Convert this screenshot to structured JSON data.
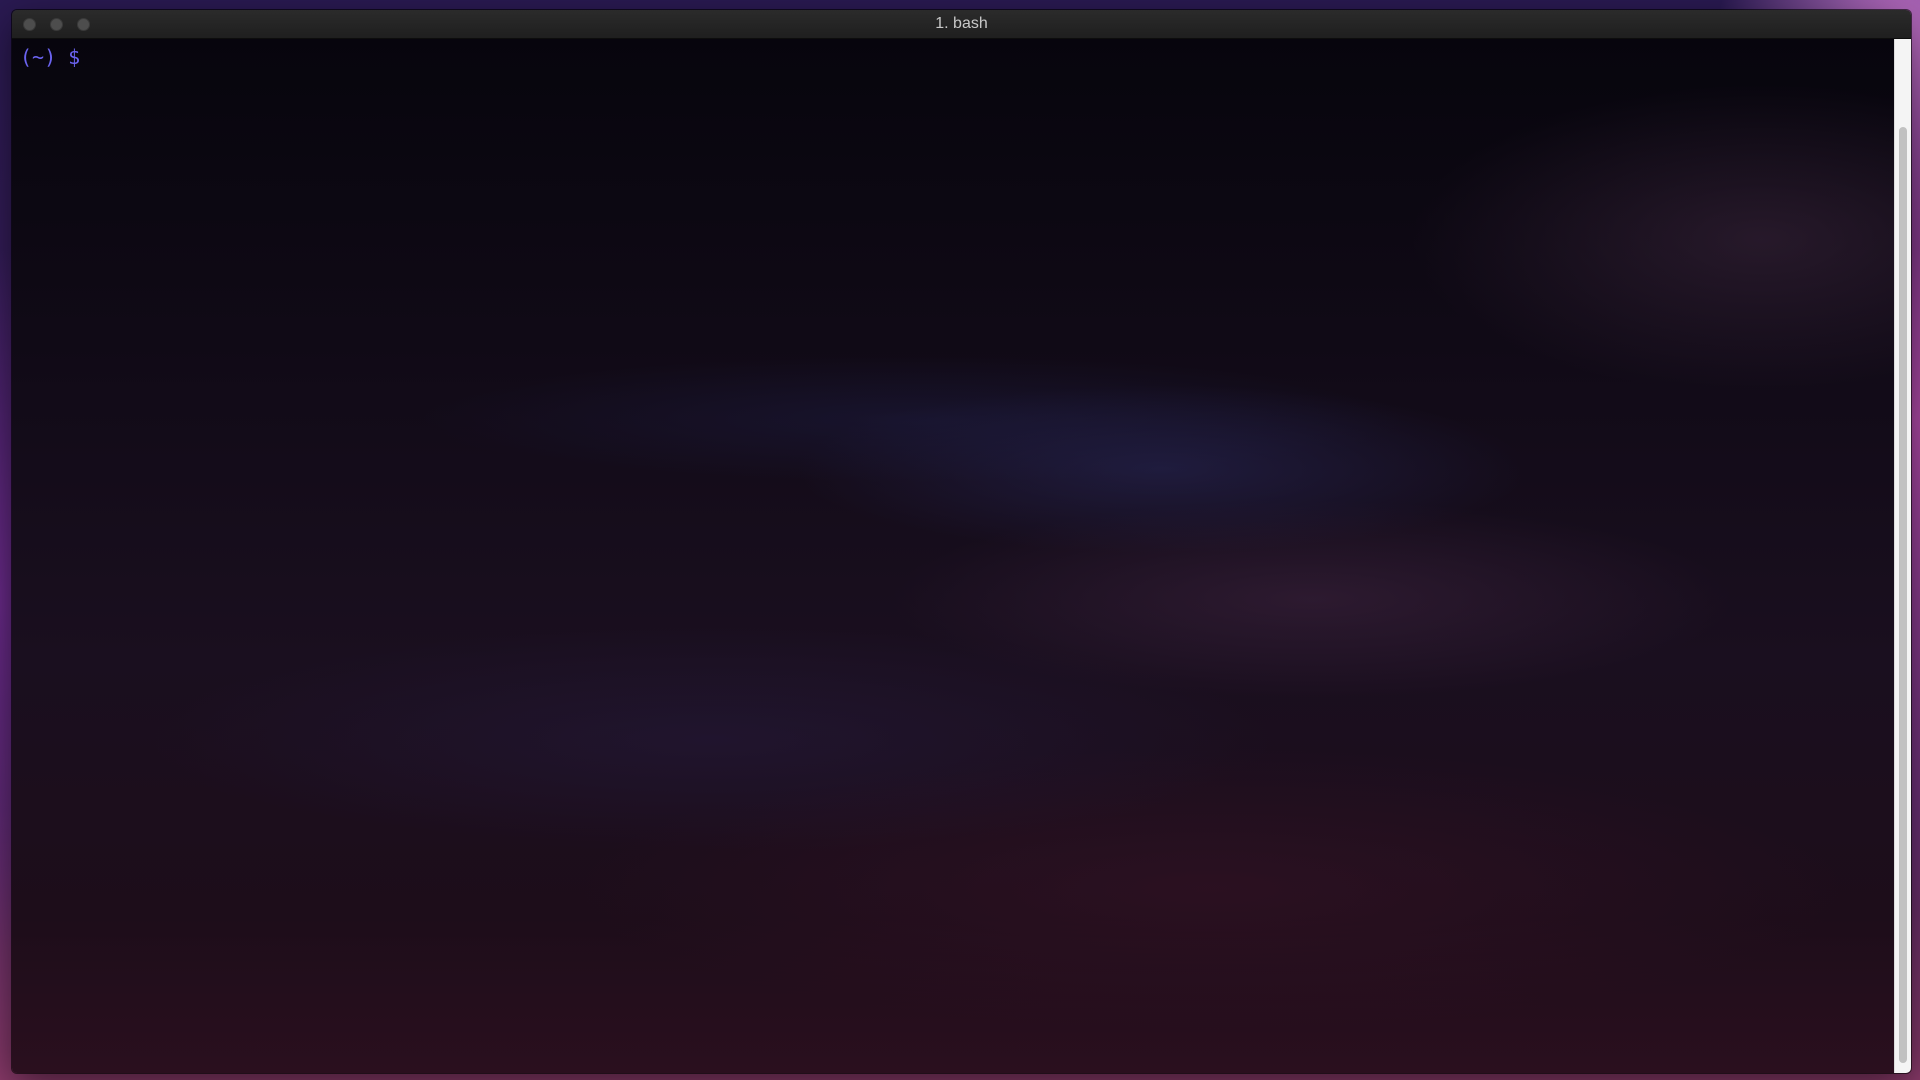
{
  "window": {
    "title": "1. bash"
  },
  "terminal": {
    "prompt_dir": "(~)",
    "prompt_symbol": "$",
    "input": ""
  },
  "icons": {
    "close": "close-button-icon",
    "minimize": "minimize-button-icon",
    "zoom": "zoom-button-icon"
  },
  "colors": {
    "prompt": "#6b63f0",
    "title_text": "#c8c8c8",
    "titlebar": "#262626"
  }
}
